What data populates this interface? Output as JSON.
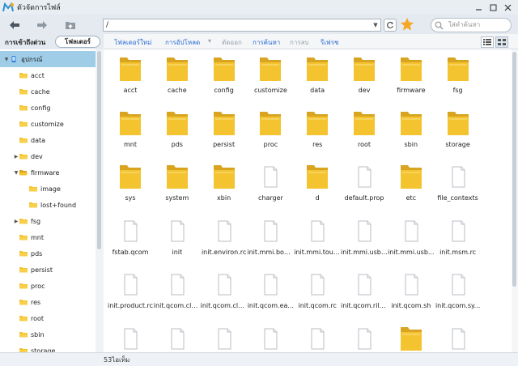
{
  "window": {
    "title": "ตัวจัดการไฟล์"
  },
  "toolbar": {
    "path": "/",
    "search_placeholder": "ใส่คำค้นหา"
  },
  "tabs": {
    "quick_access": "การเข้าถึงด่วน",
    "folder": "โฟลเดอร์"
  },
  "actions": [
    {
      "label": "โฟลเดอร์ใหม่",
      "enabled": true
    },
    {
      "label": "การอัปโหลด",
      "enabled": true
    },
    {
      "label": "▾",
      "enabled": false
    },
    {
      "label": "ตัดออก",
      "enabled": false
    },
    {
      "label": "การค้นหา",
      "enabled": true
    },
    {
      "label": "การลบ",
      "enabled": false
    },
    {
      "label": "รีเฟรช",
      "enabled": true
    }
  ],
  "sidebar": {
    "items": [
      {
        "label": "อุปกรณ์",
        "type": "device",
        "expand": "open",
        "indent": 0,
        "selected": true
      },
      {
        "label": "acct",
        "type": "folder",
        "expand": "none",
        "indent": 1
      },
      {
        "label": "cache",
        "type": "folder",
        "expand": "none",
        "indent": 1
      },
      {
        "label": "config",
        "type": "folder",
        "expand": "none",
        "indent": 1
      },
      {
        "label": "customize",
        "type": "folder",
        "expand": "none",
        "indent": 1
      },
      {
        "label": "data",
        "type": "folder",
        "expand": "none",
        "indent": 1
      },
      {
        "label": "dev",
        "type": "folder",
        "expand": "closed",
        "indent": 1
      },
      {
        "label": "firmware",
        "type": "folder-open",
        "expand": "open",
        "indent": 1
      },
      {
        "label": "image",
        "type": "folder",
        "expand": "none",
        "indent": 2
      },
      {
        "label": "lost+found",
        "type": "folder",
        "expand": "none",
        "indent": 2
      },
      {
        "label": "fsg",
        "type": "folder",
        "expand": "closed",
        "indent": 1
      },
      {
        "label": "mnt",
        "type": "folder",
        "expand": "none",
        "indent": 1
      },
      {
        "label": "pds",
        "type": "folder",
        "expand": "none",
        "indent": 1
      },
      {
        "label": "persist",
        "type": "folder",
        "expand": "none",
        "indent": 1
      },
      {
        "label": "proc",
        "type": "folder",
        "expand": "none",
        "indent": 1
      },
      {
        "label": "res",
        "type": "folder",
        "expand": "none",
        "indent": 1
      },
      {
        "label": "root",
        "type": "folder",
        "expand": "none",
        "indent": 1
      },
      {
        "label": "sbin",
        "type": "folder",
        "expand": "none",
        "indent": 1
      },
      {
        "label": "storage",
        "type": "folder",
        "expand": "none",
        "indent": 1
      }
    ]
  },
  "files": [
    {
      "name": "acct",
      "type": "folder"
    },
    {
      "name": "cache",
      "type": "folder"
    },
    {
      "name": "config",
      "type": "folder"
    },
    {
      "name": "customize",
      "type": "folder"
    },
    {
      "name": "data",
      "type": "folder"
    },
    {
      "name": "dev",
      "type": "folder"
    },
    {
      "name": "firmware",
      "type": "folder"
    },
    {
      "name": "fsg",
      "type": "folder"
    },
    {
      "name": "mnt",
      "type": "folder"
    },
    {
      "name": "pds",
      "type": "folder"
    },
    {
      "name": "persist",
      "type": "folder"
    },
    {
      "name": "proc",
      "type": "folder"
    },
    {
      "name": "res",
      "type": "folder"
    },
    {
      "name": "root",
      "type": "folder"
    },
    {
      "name": "sbin",
      "type": "folder"
    },
    {
      "name": "storage",
      "type": "folder"
    },
    {
      "name": "sys",
      "type": "folder"
    },
    {
      "name": "system",
      "type": "folder"
    },
    {
      "name": "xbin",
      "type": "folder"
    },
    {
      "name": "charger",
      "type": "file"
    },
    {
      "name": "d",
      "type": "folder"
    },
    {
      "name": "default.prop",
      "type": "file"
    },
    {
      "name": "etc",
      "type": "folder"
    },
    {
      "name": "file_contexts",
      "type": "file"
    },
    {
      "name": "fstab.qcom",
      "type": "file"
    },
    {
      "name": "init",
      "type": "file"
    },
    {
      "name": "init.environ.rc",
      "type": "file"
    },
    {
      "name": "init.mmi.boot...",
      "type": "file"
    },
    {
      "name": "init.mmi.touc...",
      "type": "file"
    },
    {
      "name": "init.mmi.usb.rc",
      "type": "file"
    },
    {
      "name": "init.mmi.usb...",
      "type": "file"
    },
    {
      "name": "init.msm.rc",
      "type": "file"
    },
    {
      "name": "init.product.rc",
      "type": "file"
    },
    {
      "name": "init.qcom.cla...",
      "type": "file"
    },
    {
      "name": "init.qcom.cla...",
      "type": "file"
    },
    {
      "name": "init.qcom.ea...",
      "type": "file"
    },
    {
      "name": "init.qcom.rc",
      "type": "file"
    },
    {
      "name": "init.qcom.ril.sh",
      "type": "file"
    },
    {
      "name": "init.qcom.sh",
      "type": "file"
    },
    {
      "name": "init.qcom.sy...",
      "type": "file"
    },
    {
      "name": "",
      "type": "file"
    },
    {
      "name": "",
      "type": "file"
    },
    {
      "name": "",
      "type": "file"
    },
    {
      "name": "",
      "type": "file"
    },
    {
      "name": "",
      "type": "file"
    },
    {
      "name": "",
      "type": "file"
    },
    {
      "name": "",
      "type": "folder"
    },
    {
      "name": "",
      "type": "file"
    }
  ],
  "status": {
    "item_count": "53ไอเท็ม"
  },
  "colors": {
    "accent": "#2b6bd1",
    "folder": "#f4c430",
    "selected": "#9fcde8",
    "star": "#f5a623"
  }
}
